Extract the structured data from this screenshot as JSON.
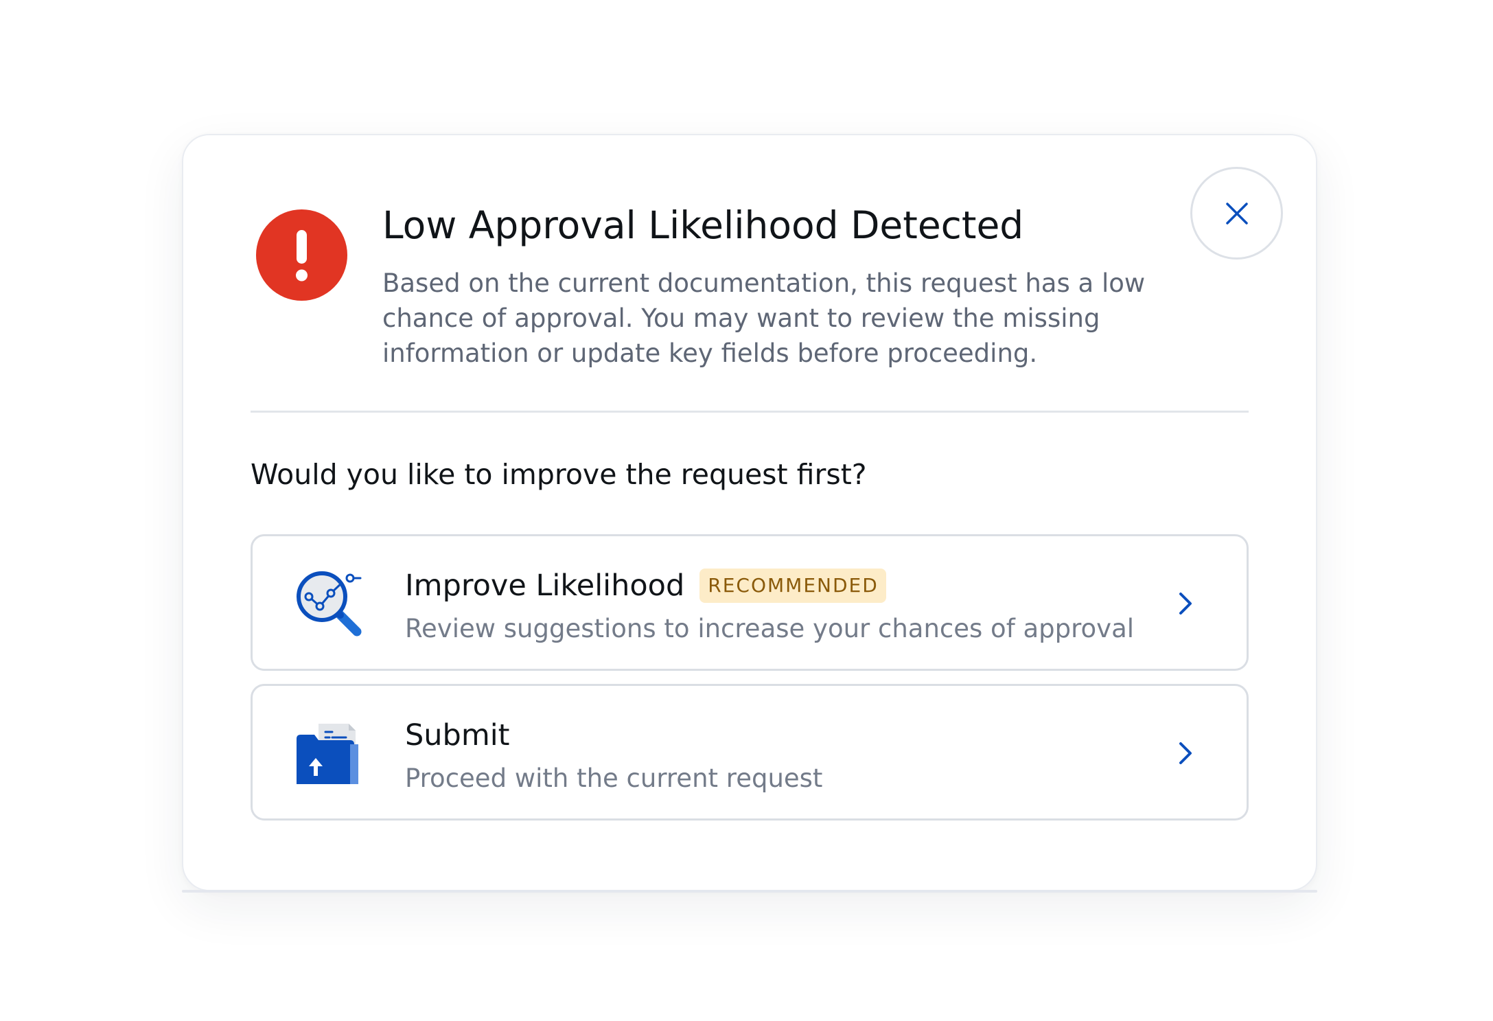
{
  "dialog": {
    "title": "Low Approval Likelihood Detected",
    "description": "Based on the current documentation, this request has a low chance of approval. You may want to review the missing information or update key fields before proceeding.",
    "question": "Would you like to improve the request first?",
    "alert_icon": "exclamation-circle-icon",
    "close_icon": "close-icon",
    "options": [
      {
        "title": "Improve Likelihood",
        "badge": "RECOMMENDED",
        "description": "Review suggestions to increase your chances of approval",
        "icon": "magnifier-chart-icon"
      },
      {
        "title": "Submit",
        "description": "Proceed with the current request",
        "icon": "folder-upload-icon"
      }
    ]
  },
  "colors": {
    "alert_red": "#e13523",
    "accent_blue": "#0b4fbd",
    "badge_background": "#fdecc8",
    "badge_text": "#8a5a0a"
  }
}
